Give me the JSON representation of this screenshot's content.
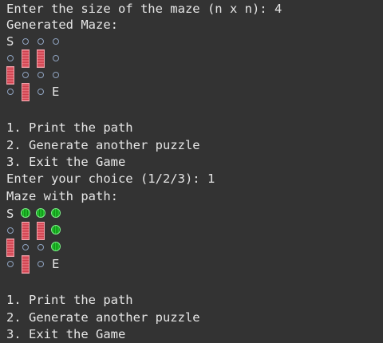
{
  "lines": [
    "Enter the size of the maze (n x n): 4",
    "Generated Maze:",
    "1. Print the path",
    "2. Generate another puzzle",
    "3. Exit the Game",
    "Enter your choice (1/2/3): 1",
    "Maze with path:",
    "1. Print the path",
    "2. Generate another puzzle",
    "3. Exit the Game"
  ],
  "mazes": {
    "generated": [
      [
        "S",
        "open",
        "open",
        "open"
      ],
      [
        "open",
        "wall",
        "wall",
        "open"
      ],
      [
        "wall",
        "open",
        "open",
        "open"
      ],
      [
        "open",
        "wall",
        "open",
        "E"
      ]
    ],
    "solved": [
      [
        "S",
        "path",
        "path",
        "path"
      ],
      [
        "open",
        "wall",
        "wall",
        "path"
      ],
      [
        "wall",
        "open",
        "open",
        "path"
      ],
      [
        "open",
        "wall",
        "open",
        "E"
      ]
    ]
  },
  "colors": {
    "background": "#333333",
    "text": "#e6e6e6",
    "wall": "#cf3f4c",
    "path": "#25c82f",
    "open_marker": "#8fa3c0"
  },
  "icons": {
    "open": "open-cell-icon",
    "wall": "wall-block-icon",
    "path": "path-dot-icon"
  }
}
